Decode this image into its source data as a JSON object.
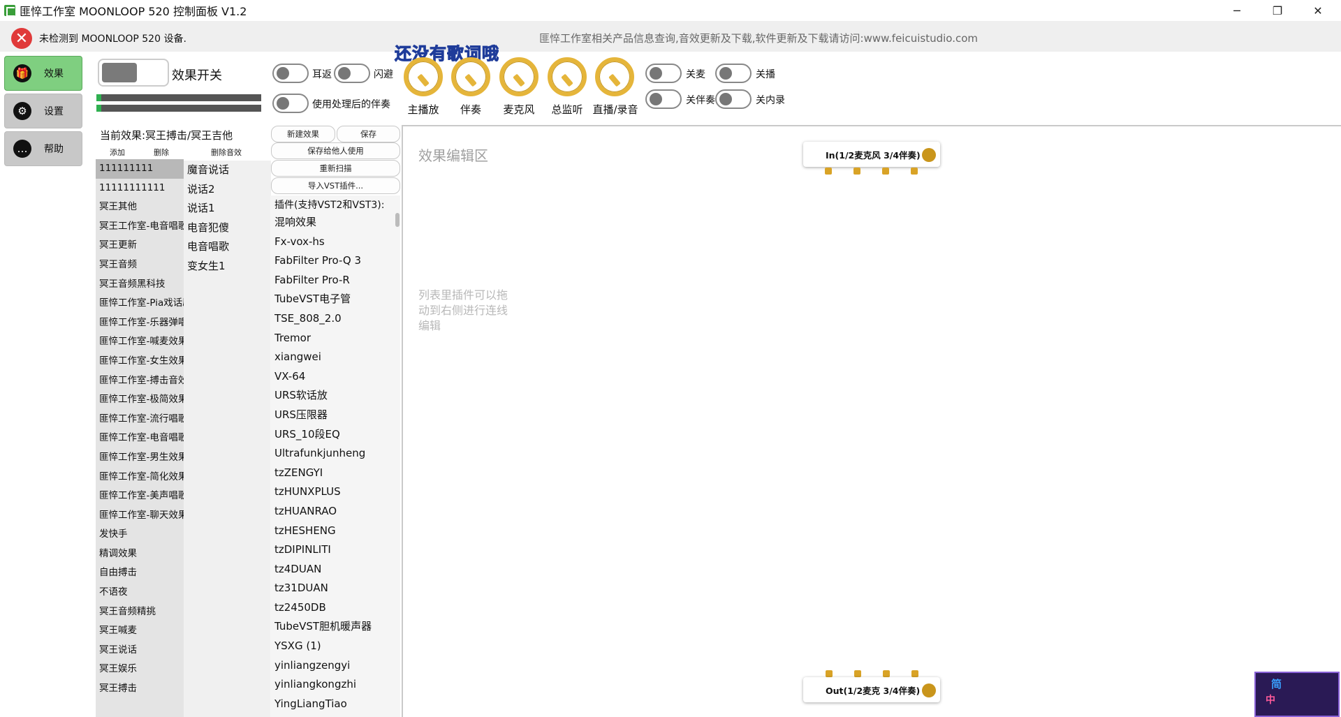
{
  "window": {
    "title": "匪悴工作室 MOONLOOP 520 控制面板 V1.2",
    "minimize": "─",
    "restore": "❐",
    "close": "✕"
  },
  "status": {
    "error_text": "未检测到 MOONLOOP 520 设备.",
    "info_text": "匪悴工作室相关产品信息查询,音效更新及下载,软件更新及下载请访问:www.feicuistudio.com"
  },
  "nav": [
    {
      "label": "效果",
      "icon": "gift-icon"
    },
    {
      "label": "设置",
      "icon": "gear-icon"
    },
    {
      "label": "帮助",
      "icon": "chat-icon"
    }
  ],
  "effect_switch": {
    "label": "效果开关"
  },
  "toggles": {
    "ear_return": "耳返",
    "flash": "闪避",
    "use_processed": "使用处理后的伴奏",
    "mute_mic": "关麦",
    "mute_broadcast": "关播",
    "mute_backing": "关伴奏",
    "mute_internal": "关内录"
  },
  "lyrics_text": "还没有歌词哦",
  "knobs": [
    {
      "label": "主播放"
    },
    {
      "label": "伴奏"
    },
    {
      "label": "麦克风"
    },
    {
      "label": "总监听"
    },
    {
      "label": "直播/录音"
    }
  ],
  "current_effect": "当前效果:冥王搏击/冥王吉他",
  "left_actions": {
    "add": "添加",
    "delete": "删除",
    "delete_fx": "删除音效"
  },
  "buttons": {
    "new_effect": "新建效果",
    "save": "保存",
    "save_for_others": "保存给他人使用",
    "rescan": "重新扫描",
    "import_vst": "导入VST插件..."
  },
  "effect_groups": [
    "111111111",
    "11111111111",
    "冥王其他",
    "冥王工作室-电音唱歌",
    "冥王更新",
    "冥王音频",
    "冥王音频黑科技",
    "匪悴工作室-Pia戏话剧",
    "匪悴工作室-乐器弹唱",
    "匪悴工作室-喊麦效果",
    "匪悴工作室-女生效果",
    "匪悴工作室-搏击音效",
    "匪悴工作室-极简效果",
    "匪悴工作室-流行唱歌",
    "匪悴工作室-电音唱歌",
    "匪悴工作室-男生效果",
    "匪悴工作室-简化效果",
    "匪悴工作室-美声唱歌",
    "匪悴工作室-聊天效果",
    "发快手",
    "精调效果",
    "自由搏击",
    "不语夜",
    "冥王音频精挑",
    "冥王喊麦",
    "冥王说话",
    "冥王娱乐",
    "冥王搏击"
  ],
  "effects": [
    "魔音说话",
    "说话2",
    "说话1",
    "电音犯傻",
    "电音唱歌",
    "变女生1"
  ],
  "plugins": {
    "header": "插件(支持VST2和VST3):",
    "items": [
      "混响效果",
      "Fx-vox-hs",
      "FabFilter Pro-Q 3",
      "FabFilter Pro-R",
      "TubeVST电子管",
      "TSE_808_2.0",
      "Tremor",
      "xiangwei",
      "VX-64",
      "URS软话放",
      "URS压限器",
      "URS_10段EQ",
      "Ultrafunkjunheng",
      "tzZENGYI",
      "tzHUNXPLUS",
      "tzHUANRAO",
      "tzHESHENG",
      "tzDIPINLITI",
      "tz4DUAN",
      "tz31DUAN",
      "tz2450DB",
      "TubeVST胆机暖声器",
      "YSXG (1)",
      "yinliangzengyi",
      "yinliangkongzhi",
      "YingLiangTiao"
    ]
  },
  "editor": {
    "title": "效果编辑区",
    "hint": "列表里插件可以拖动到右侧进行连线编辑",
    "input_node": "In(1/2麦克风 3/4伴奏)",
    "output_node": "Out(1/2麦克 3/4伴奏)"
  },
  "corner_widget": {
    "line1": "简",
    "line2": "中"
  }
}
